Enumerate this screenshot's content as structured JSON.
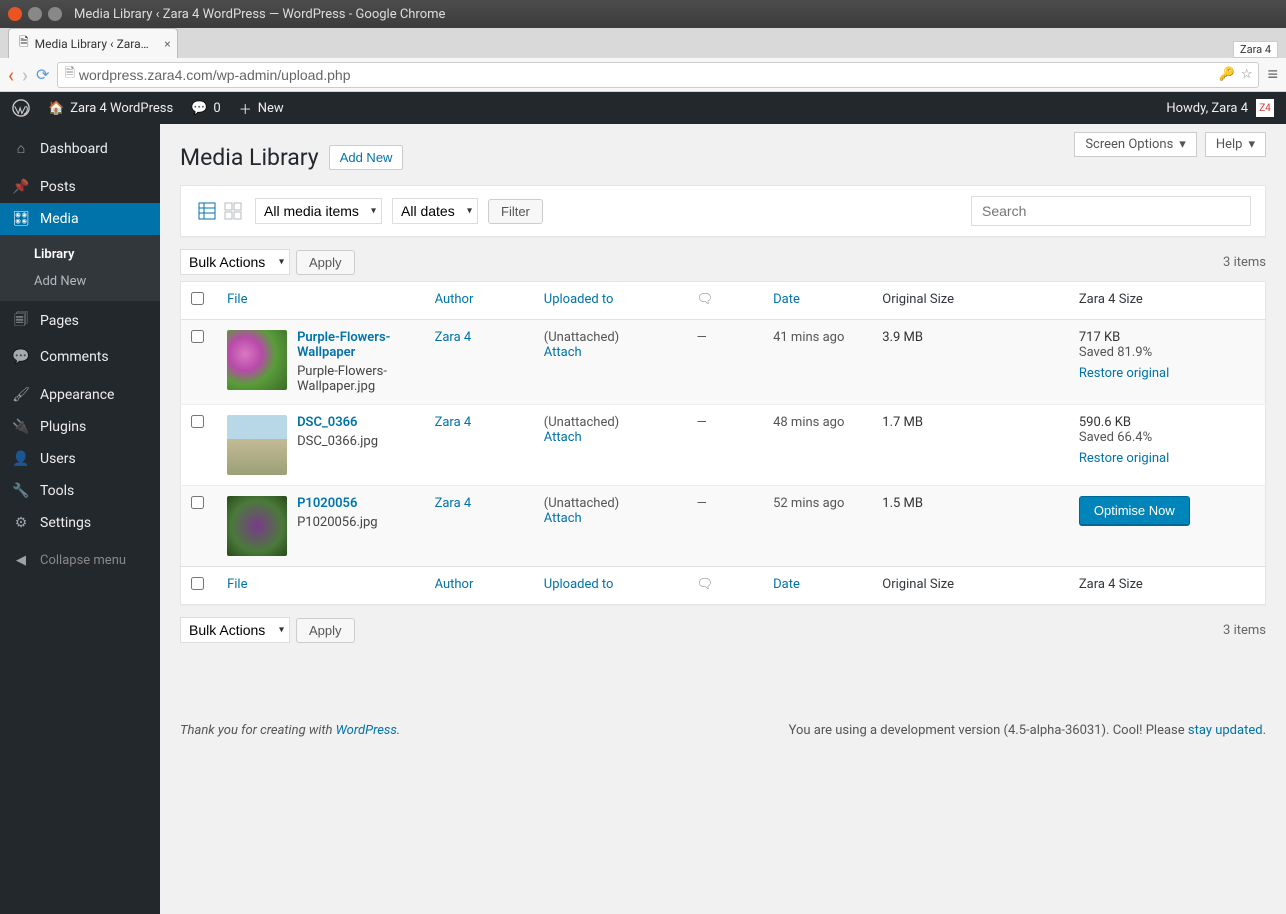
{
  "window": {
    "title": "Media Library ‹ Zara 4 WordPress — WordPress - Google Chrome"
  },
  "tab": {
    "title": "Media Library ‹ Zara…",
    "ext_badge": "Zara 4"
  },
  "url": "wordpress.zara4.com/wp-admin/upload.php",
  "adminbar": {
    "site": "Zara 4 WordPress",
    "comments": "0",
    "new": "New",
    "howdy": "Howdy, Zara 4",
    "avatar": "Z4"
  },
  "menu": {
    "dashboard": "Dashboard",
    "posts": "Posts",
    "media": "Media",
    "media_sub": {
      "library": "Library",
      "add_new": "Add New"
    },
    "pages": "Pages",
    "comments": "Comments",
    "appearance": "Appearance",
    "plugins": "Plugins",
    "users": "Users",
    "tools": "Tools",
    "settings": "Settings",
    "collapse": "Collapse menu"
  },
  "topright": {
    "screen_options": "Screen Options",
    "help": "Help"
  },
  "page": {
    "title": "Media Library",
    "add_new": "Add New",
    "filter_type": "All media items",
    "filter_date": "All dates",
    "filter_btn": "Filter",
    "search_placeholder": "Search",
    "bulk_actions": "Bulk Actions",
    "apply": "Apply",
    "items_count": "3 items"
  },
  "columns": {
    "file": "File",
    "author": "Author",
    "uploaded_to": "Uploaded to",
    "date": "Date",
    "original_size": "Original Size",
    "zara4_size": "Zara 4 Size"
  },
  "rows": [
    {
      "title": "Purple-Flowers-Wallpaper",
      "filename": "Purple-Flowers-Wallpaper.jpg",
      "author": "Zara 4",
      "uploaded": "(Unattached)",
      "attach": "Attach",
      "comments": "—",
      "date": "41 mins ago",
      "original": "3.9 MB",
      "z_size": "717 KB",
      "z_saved": "Saved 81.9%",
      "z_action": "Restore original",
      "z_optimise": ""
    },
    {
      "title": "DSC_0366",
      "filename": "DSC_0366.jpg",
      "author": "Zara 4",
      "uploaded": "(Unattached)",
      "attach": "Attach",
      "comments": "—",
      "date": "48 mins ago",
      "original": "1.7 MB",
      "z_size": "590.6 KB",
      "z_saved": "Saved 66.4%",
      "z_action": "Restore original",
      "z_optimise": ""
    },
    {
      "title": "P1020056",
      "filename": "P1020056.jpg",
      "author": "Zara 4",
      "uploaded": "(Unattached)",
      "attach": "Attach",
      "comments": "—",
      "date": "52 mins ago",
      "original": "1.5 MB",
      "z_size": "",
      "z_saved": "",
      "z_action": "",
      "z_optimise": "Optimise Now"
    }
  ],
  "footer": {
    "thanks_pre": "Thank you for creating with ",
    "thanks_link": "WordPress",
    "dev_pre": "You are using a development version (4.5-alpha-36031). Cool! Please ",
    "dev_link": "stay updated"
  }
}
